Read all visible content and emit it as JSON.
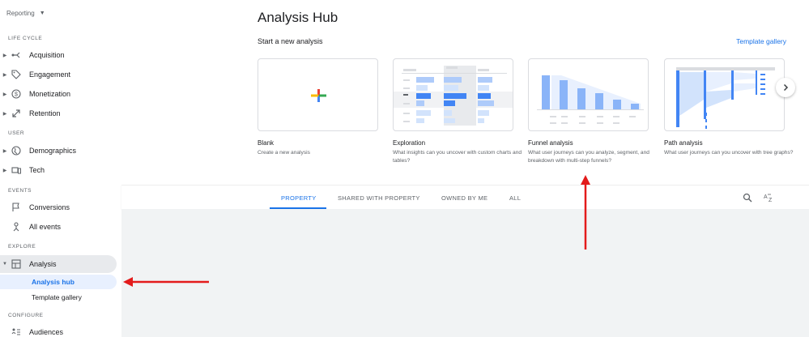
{
  "sidebar": {
    "property_selector": "Reporting",
    "sections": [
      {
        "label": "LIFE CYCLE"
      },
      {
        "label": "USER"
      },
      {
        "label": "EVENTS"
      },
      {
        "label": "EXPLORE"
      },
      {
        "label": "CONFIGURE"
      }
    ],
    "items": {
      "acquisition": "Acquisition",
      "engagement": "Engagement",
      "monetization": "Monetization",
      "retention": "Retention",
      "demographics": "Demographics",
      "tech": "Tech",
      "conversions": "Conversions",
      "all_events": "All events",
      "analysis": "Analysis",
      "analysis_hub": "Analysis hub",
      "template_gallery": "Template gallery",
      "audiences": "Audiences"
    }
  },
  "main": {
    "title": "Analysis Hub",
    "subtitle": "Start a new analysis",
    "template_gallery_link": "Template gallery",
    "cards": [
      {
        "name": "Blank",
        "desc": "Create a new analysis"
      },
      {
        "name": "Exploration",
        "desc": "What insights can you uncover with custom charts and tables?"
      },
      {
        "name": "Funnel analysis",
        "desc": "What user journeys can you analyze, segment, and breakdown with multi-step funnels?"
      },
      {
        "name": "Path analysis",
        "desc": "What user journeys can you uncover with tree graphs?"
      }
    ],
    "tabs": [
      "PROPERTY",
      "SHARED WITH PROPERTY",
      "OWNED BY ME",
      "ALL"
    ],
    "active_tab": "PROPERTY"
  },
  "colors": {
    "accent": "#1a73e8",
    "annotation_arrow": "#e31b1b",
    "plus_red": "#ea4335",
    "plus_blue": "#4285f4",
    "plus_yellow": "#fbbc04",
    "plus_green": "#34a853"
  },
  "icons": [
    "chevron-down-icon",
    "acquisition-icon",
    "engagement-tag-icon",
    "monetization-dollar-icon",
    "retention-icon",
    "globe-icon",
    "devices-icon",
    "flag-icon",
    "events-icon",
    "analysis-icon",
    "audiences-icon",
    "search-icon",
    "sort-az-icon",
    "chevron-right-icon"
  ]
}
